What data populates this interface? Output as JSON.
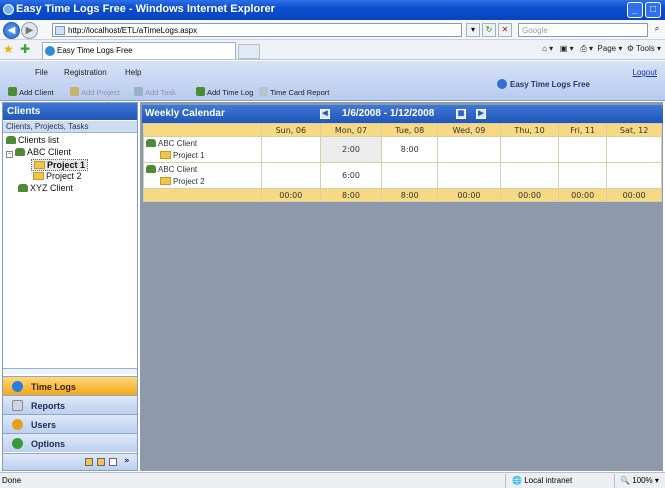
{
  "window": {
    "title": "Easy Time Logs Free - Windows Internet Explorer",
    "minimize": "_",
    "maximize": "□"
  },
  "browser": {
    "url": "http://localhost/ETL/aTimeLogs.aspx",
    "search_placeholder": "Google",
    "tab_title": "Easy Time Logs Free",
    "page_menu": "Page",
    "tools_menu": "Tools"
  },
  "app": {
    "menu": [
      "File",
      "Registration",
      "Help"
    ],
    "logout": "Logout",
    "logo": "Easy Time Logs Free",
    "toolbar": [
      {
        "label": "Add Client",
        "enabled": true,
        "color": "#4d8a34"
      },
      {
        "label": "Add Project",
        "enabled": false,
        "color": "#c7b26a"
      },
      {
        "label": "Add Task",
        "enabled": false,
        "color": "#9ab2c8"
      },
      {
        "label": "Add Time Log",
        "enabled": true,
        "color": "#4d8a34"
      },
      {
        "label": "Time Card Report",
        "enabled": true,
        "color": "#b9c3d0"
      }
    ]
  },
  "sidebar": {
    "title": "Clients",
    "subtitle": "Clients, Projects, Tasks",
    "tree": {
      "root": "Clients list",
      "client1": "ABC Client",
      "project1": "Project 1",
      "project2": "Project 2",
      "client2": "XYZ Client"
    },
    "nav": [
      {
        "label": "Time Logs",
        "selected": true,
        "icon": "clock-icon",
        "color": "#2a7de0"
      },
      {
        "label": "Reports",
        "selected": false,
        "icon": "report-icon",
        "color": "#cfd6e2"
      },
      {
        "label": "Users",
        "selected": false,
        "icon": "users-icon",
        "color": "#e0a020"
      },
      {
        "label": "Options",
        "selected": false,
        "icon": "options-icon",
        "color": "#3a9a3a"
      }
    ],
    "footer_more": "»"
  },
  "calendar": {
    "title": "Weekly Calendar",
    "range": "1/6/2008 - 1/12/2008",
    "days": [
      "Sun, 06",
      "Mon, 07",
      "Tue, 08",
      "Wed, 09",
      "Thu, 10",
      "Fri, 11",
      "Sat, 12"
    ],
    "rows": [
      {
        "client": "ABC Client",
        "project": "Project 1",
        "values": [
          "",
          "2:00",
          "8:00",
          "",
          "",
          "",
          ""
        ]
      },
      {
        "client": "ABC Client",
        "project": "Project 2",
        "values": [
          "",
          "6:00",
          "",
          "",
          "",
          "",
          ""
        ]
      }
    ],
    "totals": [
      "00:00",
      "8:00",
      "8:00",
      "00:00",
      "00:00",
      "00:00",
      "00:00"
    ]
  },
  "status": {
    "left": "Done",
    "zone": "Local intranet",
    "zoom": "100%"
  }
}
